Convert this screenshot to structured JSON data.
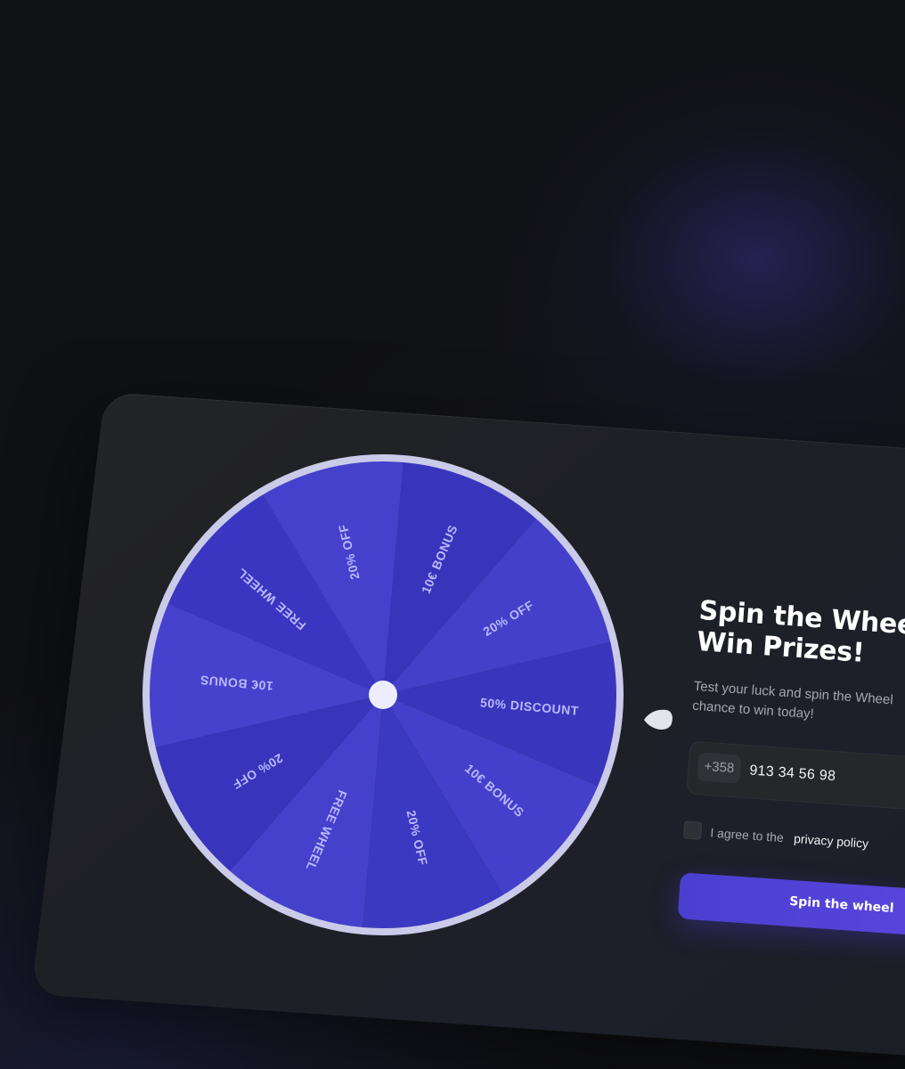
{
  "wheel": {
    "segments": [
      {
        "label": "50% DISCOUNT",
        "color": "#3936bd"
      },
      {
        "label": "10€ BONUS",
        "color": "#4440cb"
      },
      {
        "label": "20% OFF",
        "color": "#3b38c2"
      },
      {
        "label": "FREE WHEEL",
        "color": "#4541cc"
      },
      {
        "label": "20% OFF",
        "color": "#3834bb"
      },
      {
        "label": "10€ BONUS",
        "color": "#4642ce"
      },
      {
        "label": "FREE WHEEL",
        "color": "#3a36c1"
      },
      {
        "label": "20% OFF",
        "color": "#4541cc"
      },
      {
        "label": "10€ BONUS",
        "color": "#3835bc"
      },
      {
        "label": "20% OFF",
        "color": "#4440ca"
      }
    ],
    "rim_color": "#c9cbe8",
    "hub_color": "#eceeff",
    "label_color": "#b9b8ff"
  },
  "panel": {
    "title": "Spin the Wheel\nWin Prizes!",
    "subtitle": "Test your luck and spin the Wheel\nchance to win today!",
    "phone": {
      "country_code": "+358",
      "value": "913 34 56 98"
    },
    "agree": {
      "text": "I agree to the",
      "link": "privacy policy"
    },
    "button_label": "Spin the wheel"
  },
  "colors": {
    "accent": "#4a3fd1",
    "background": "#101113",
    "card": "#202128"
  }
}
